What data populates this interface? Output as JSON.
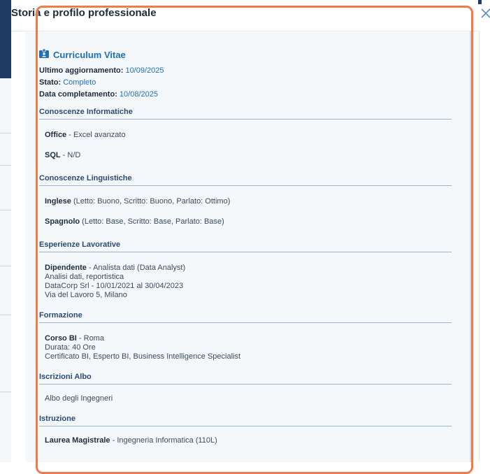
{
  "modal": {
    "title": "Storia e profilo professionale",
    "close_label": "Chiudi"
  },
  "cv": {
    "title": "Curriculum Vitae",
    "meta": [
      {
        "label": "Ultimo aggiornamento:",
        "value": " 10/09/2025"
      },
      {
        "label": "Stato:",
        "value": " Completo"
      },
      {
        "label": "Data completamento:",
        "value": " 10/08/2025"
      }
    ],
    "sections": {
      "informatiche": {
        "title": "Conoscenze Informatiche",
        "items": [
          {
            "name": "Office",
            "detail": " - Excel avanzato"
          },
          {
            "name": "SQL",
            "detail": " - N/D"
          }
        ]
      },
      "linguistiche": {
        "title": "Conoscenze Linguistiche",
        "items": [
          {
            "name": "Inglese",
            "detail": " (Letto: Buono, Scritto: Buono, Parlato: Ottimo)"
          },
          {
            "name": "Spagnolo",
            "detail": " (Letto: Base, Scritto: Base, Parlato: Base)"
          }
        ]
      },
      "esperienze": {
        "title": "Esperienze Lavorative",
        "role": "Dipendente",
        "role_detail": " - Analista dati (Data Analyst)",
        "line1": "Analisi dati, reportistica",
        "line2": "DataCorp Srl - 10/01/2021 al 30/04/2023",
        "line3": "Via del Lavoro 5, Milano"
      },
      "formazione": {
        "title": "Formazione",
        "course": "Corso BI",
        "course_detail": " - Roma",
        "line1": "Durata: 40 Ore",
        "line2": "Certificato BI, Esperto BI, Business Intelligence Specialist"
      },
      "albo": {
        "title": "Iscrizioni Albo",
        "item": "Albo degli Ingegneri"
      },
      "istruzione": {
        "title": "Istruzione",
        "degree": "Laurea Magistrale",
        "degree_detail": " - Ingegneria Informatica (110L)"
      }
    }
  },
  "colors": {
    "accent": "#1f6fb2",
    "highlight": "#f07a4a",
    "navy": "#1f3a63"
  }
}
